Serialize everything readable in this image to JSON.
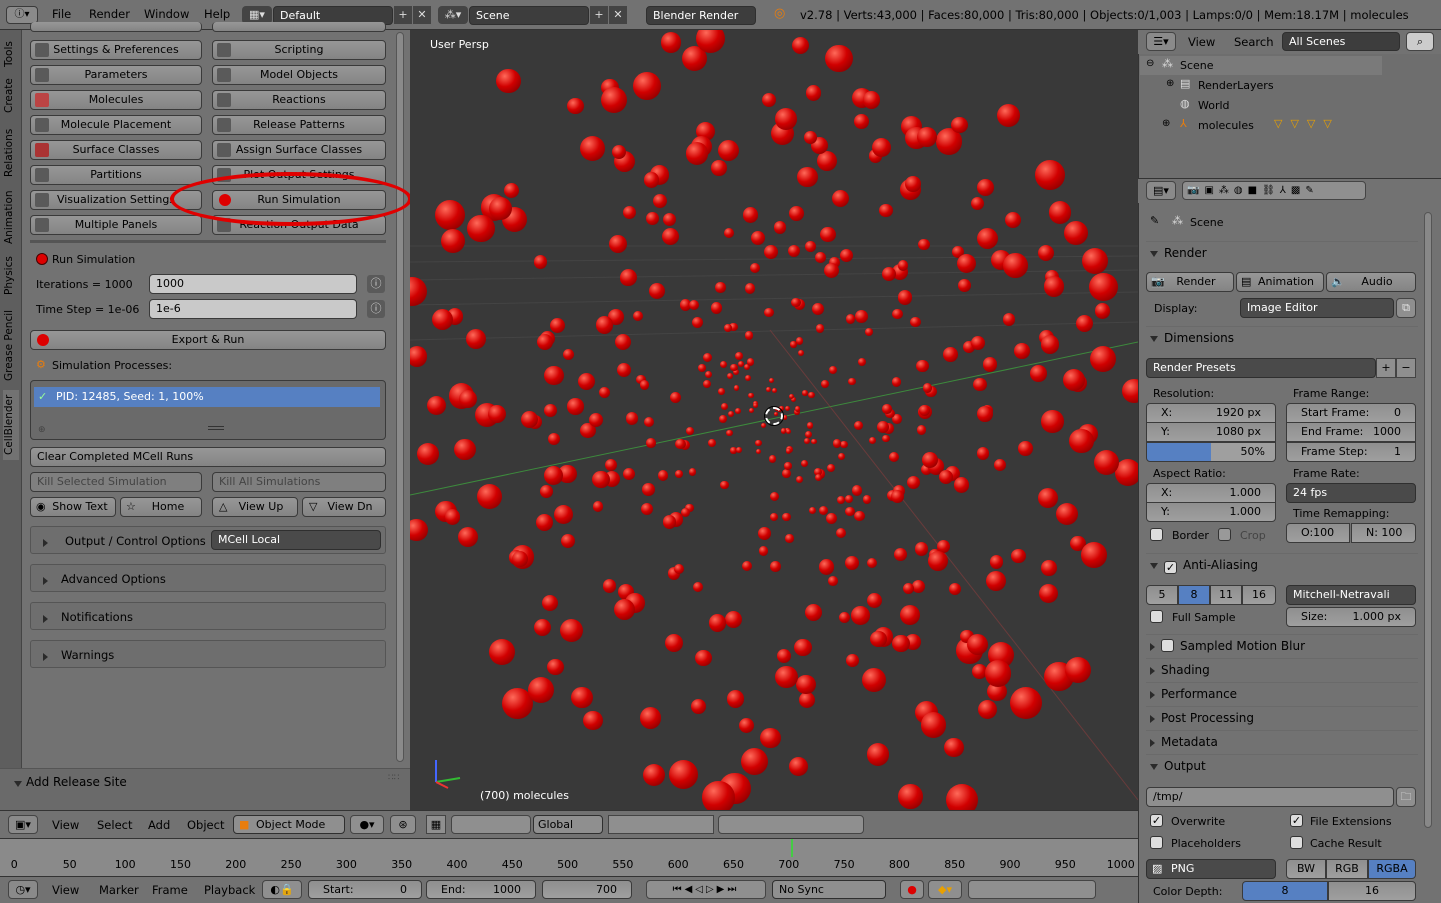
{
  "topbar": {
    "menus": [
      "File",
      "Render",
      "Window",
      "Help"
    ],
    "screen_layout": "Default",
    "scene": "Scene",
    "engine": "Blender Render",
    "stats": "v2.78 | Verts:43,000 | Faces:80,000 | Tris:80,000 | Objects:0/1,003 | Lamps:0/0 | Mem:18.17M | molecules"
  },
  "sidetabs": [
    "Tools",
    "Create",
    "Relations",
    "Animation",
    "Physics",
    "Grease Pencil",
    "CellBlender"
  ],
  "cellblender": {
    "buttons_left": [
      "Settings & Preferences",
      "Parameters",
      "Molecules",
      "Molecule Placement",
      "Surface Classes",
      "Partitions",
      "Visualization Settings",
      "Multiple Panels"
    ],
    "buttons_right": [
      "Scripting",
      "Model Objects",
      "Reactions",
      "Release Patterns",
      "Assign Surface Classes",
      "Plot Output Settings",
      "Run Simulation",
      "Reaction Output Data"
    ],
    "run_title": "Run Simulation",
    "iterations_label": "Iterations = 1000",
    "iterations_value": "1000",
    "timestep_label": "Time Step = 1e-06",
    "timestep_value": "1e-6",
    "export_run": "Export & Run",
    "sim_processes": "Simulation Processes:",
    "process_item": "PID: 12485, Seed: 1, 100%",
    "clear_runs": "Clear Completed MCell Runs",
    "kill_selected": "Kill Selected Simulation",
    "kill_all": "Kill All Simulations",
    "show_text": "Show Text",
    "home": "Home",
    "view_up": "View Up",
    "view_dn": "View Dn",
    "output_control": "Output / Control Options",
    "mcell_local": "MCell Local",
    "advanced": "Advanced Options",
    "notifications": "Notifications",
    "warnings": "Warnings",
    "add_release": "Add Release Site"
  },
  "viewport": {
    "label": "User Persp",
    "object_count": "(700) molecules"
  },
  "view_header": {
    "menus": [
      "View",
      "Select",
      "Add",
      "Object"
    ],
    "mode": "Object Mode",
    "orientation": "Global"
  },
  "timeline": {
    "ticks": [
      "0",
      "50",
      "100",
      "150",
      "200",
      "250",
      "300",
      "350",
      "400",
      "450",
      "500",
      "550",
      "600",
      "650",
      "700",
      "750",
      "800",
      "850",
      "900",
      "950",
      "1000"
    ],
    "menus": [
      "View",
      "Marker",
      "Frame",
      "Playback"
    ],
    "start_label": "Start:",
    "start_value": "0",
    "end_label": "End:",
    "end_value": "1000",
    "current": "700",
    "sync": "No Sync"
  },
  "outliner": {
    "menus": [
      "View",
      "Search"
    ],
    "filter": "All Scenes",
    "items": [
      "Scene",
      "RenderLayers",
      "World",
      "molecules"
    ]
  },
  "properties": {
    "scene": "Scene",
    "render_panel": "Render",
    "render_btns": [
      "Render",
      "Animation",
      "Audio"
    ],
    "display_label": "Display:",
    "display_value": "Image Editor",
    "dimensions": "Dimensions",
    "render_presets": "Render Presets",
    "resolution": "Resolution:",
    "res_x_label": "X:",
    "res_x": "1920 px",
    "res_y_label": "Y:",
    "res_y": "1080 px",
    "res_pct": "50%",
    "frame_range": "Frame Range:",
    "start_frame_label": "Start Frame:",
    "start_frame": "0",
    "end_frame_label": "End Frame:",
    "end_frame": "1000",
    "frame_step_label": "Frame Step:",
    "frame_step": "1",
    "aspect": "Aspect Ratio:",
    "asp_x_label": "X:",
    "asp_x": "1.000",
    "asp_y_label": "Y:",
    "asp_y": "1.000",
    "frame_rate": "Frame Rate:",
    "fps": "24 fps",
    "time_remap": "Time Remapping:",
    "remap_old": "O:100",
    "remap_new": "N: 100",
    "border": "Border",
    "crop": "Crop",
    "aa": "Anti-Aliasing",
    "aa_samples": [
      "5",
      "8",
      "11",
      "16"
    ],
    "filter": "Mitchell-Netravali",
    "full_sample": "Full Sample",
    "size_label": "Size:",
    "size_value": "1.000 px",
    "collapsed": [
      "Sampled Motion Blur",
      "Shading",
      "Performance",
      "Post Processing",
      "Metadata"
    ],
    "output": "Output",
    "path": "/tmp/",
    "overwrite": "Overwrite",
    "file_ext": "File Extensions",
    "placeholders": "Placeholders",
    "cache": "Cache Result",
    "format": "PNG",
    "color_modes": [
      "BW",
      "RGB",
      "RGBA"
    ],
    "color_depth_label": "Color Depth:",
    "depth_8": "8",
    "depth_16": "16"
  },
  "colors": {
    "accent_blue": "#5680c2",
    "molecule_red": "#d10000",
    "annotation_red": "#e00000"
  }
}
